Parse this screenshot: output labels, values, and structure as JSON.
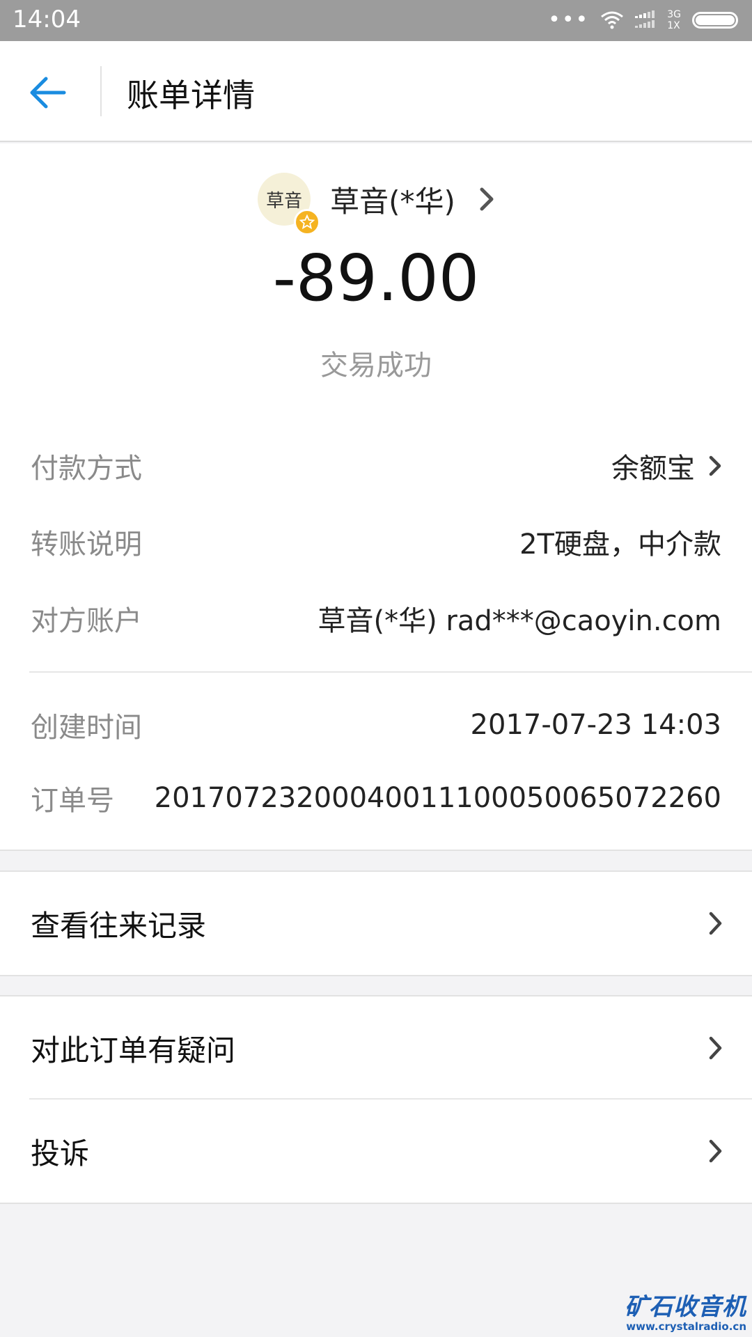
{
  "status_bar": {
    "time": "14:04",
    "dots": "•••",
    "network_top": "3G",
    "network_bottom": "1X",
    "icons": [
      "wifi-icon",
      "signal-icon",
      "battery-icon"
    ]
  },
  "nav": {
    "back_icon": "arrow-left-icon",
    "title": "账单详情",
    "accent_color": "#1a8ce0"
  },
  "payee": {
    "avatar_text": "草音",
    "name": "草音(*华)",
    "badge_icon": "star-icon",
    "badge_color": "#f5b321"
  },
  "amount": "-89.00",
  "status": "交易成功",
  "details": [
    {
      "label": "付款方式",
      "value": "余额宝"
    },
    {
      "label": "转账说明",
      "value": "2T硬盘，中介款"
    },
    {
      "label": "对方账户",
      "value": "草音(*华) rad***@caoyin.com"
    },
    {
      "label": "创建时间",
      "value": "2017-07-23 14:03"
    },
    {
      "label": "订单号",
      "value": "2017072320004001110005006507226​0"
    }
  ],
  "menu": {
    "history": "查看往来记录",
    "question": "对此订单有疑问",
    "complaint": "投诉"
  },
  "watermark": {
    "title": "矿石收音机",
    "url": "www.crystalradio.cn"
  }
}
